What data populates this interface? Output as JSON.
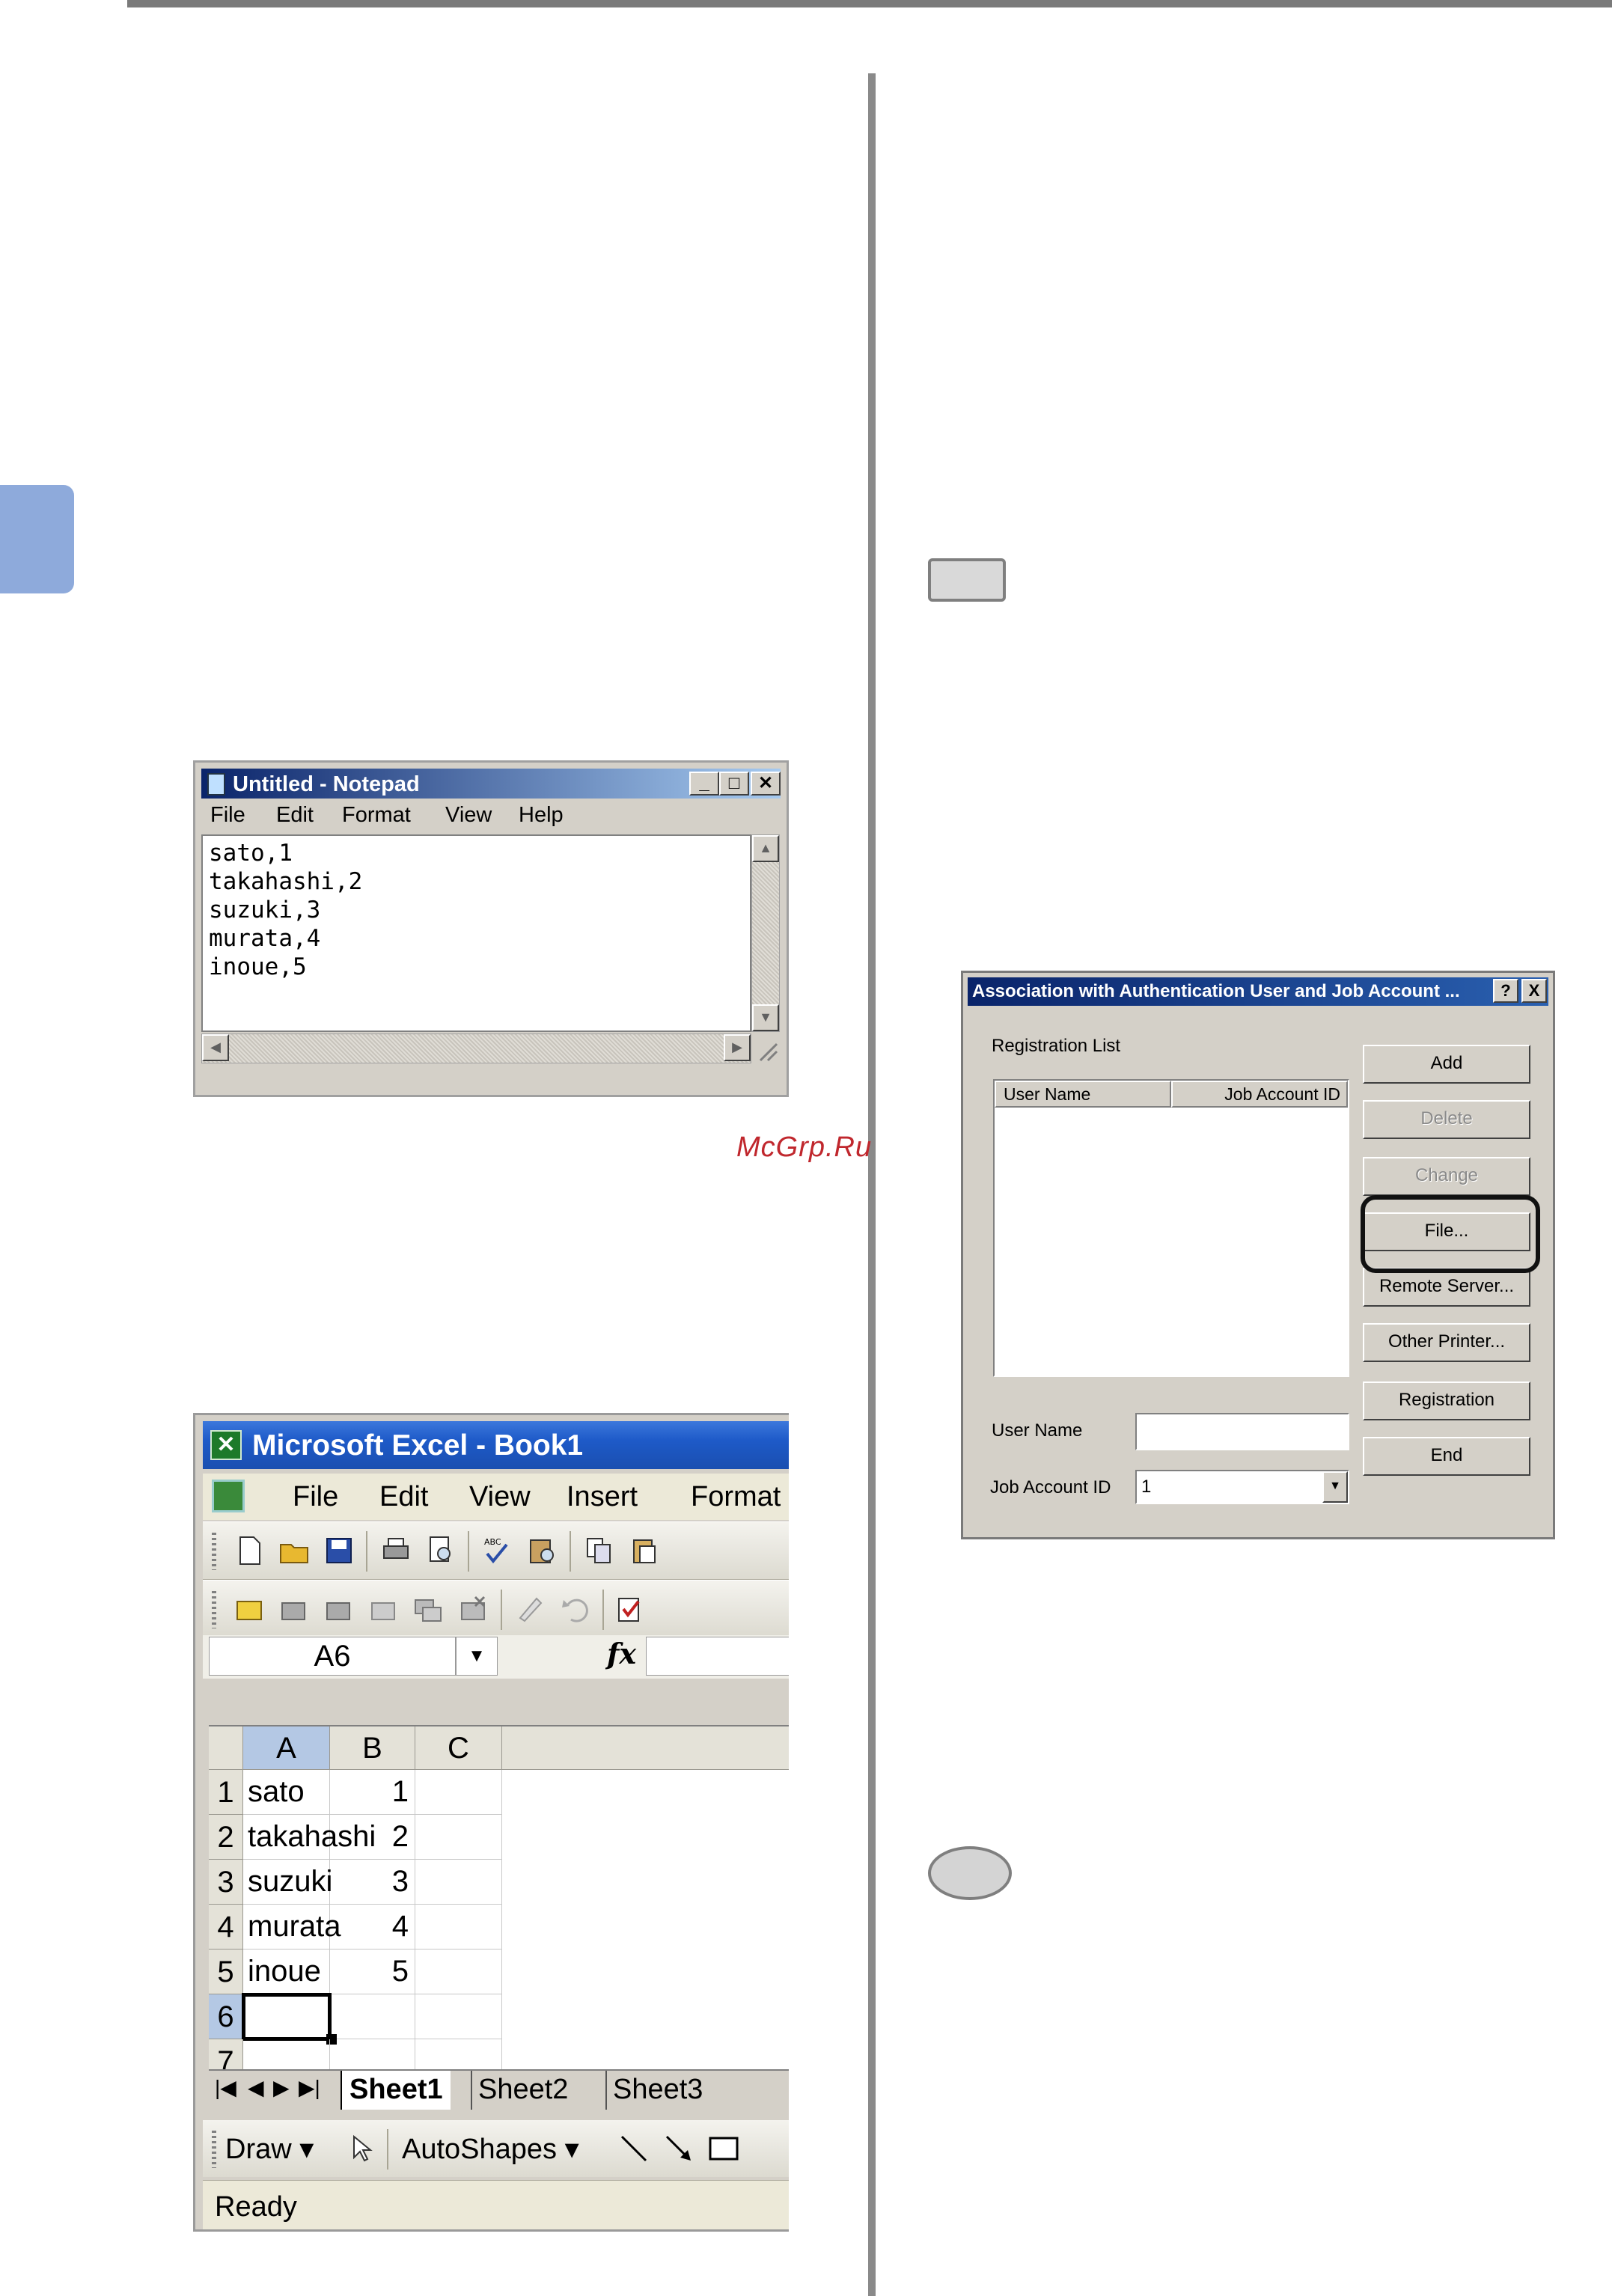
{
  "watermark": "McGrp.Ru",
  "notepad": {
    "title": "Untitled - Notepad",
    "menu": [
      "File",
      "Edit",
      "Format",
      "View",
      "Help"
    ],
    "lines": [
      "sato,1",
      "takahashi,2",
      "suzuki,3",
      "murata,4",
      "inoue,5"
    ]
  },
  "excel": {
    "title": "Microsoft Excel - Book1",
    "menu": [
      "File",
      "Edit",
      "View",
      "Insert",
      "Format"
    ],
    "name_box": "A6",
    "fx": "fx",
    "columns": [
      "A",
      "B",
      "C"
    ],
    "rows": [
      {
        "num": "1",
        "a": "sato",
        "b": "1"
      },
      {
        "num": "2",
        "a": "takahashi",
        "b": "2"
      },
      {
        "num": "3",
        "a": "suzuki",
        "b": "3"
      },
      {
        "num": "4",
        "a": "murata",
        "b": "4"
      },
      {
        "num": "5",
        "a": "inoue",
        "b": "5"
      },
      {
        "num": "6",
        "a": "",
        "b": ""
      },
      {
        "num": "7",
        "a": "",
        "b": ""
      }
    ],
    "sheets": [
      "Sheet1",
      "Sheet2",
      "Sheet3"
    ],
    "draw_label": "Draw",
    "autoshapes_label": "AutoShapes",
    "status": "Ready"
  },
  "dialog": {
    "title": "Association with Authentication User and Job Account ...",
    "help": "?",
    "close": "X",
    "registration_list_label": "Registration List",
    "col_user": "User Name",
    "col_job": "Job Account ID",
    "buttons": {
      "add": "Add",
      "delete": "Delete",
      "change": "Change",
      "file": "File...",
      "remote_server": "Remote Server...",
      "other_printer": "Other Printer...",
      "registration": "Registration",
      "end": "End"
    },
    "user_name_label": "User Name",
    "job_account_label": "Job Account ID",
    "job_account_value": "1"
  }
}
